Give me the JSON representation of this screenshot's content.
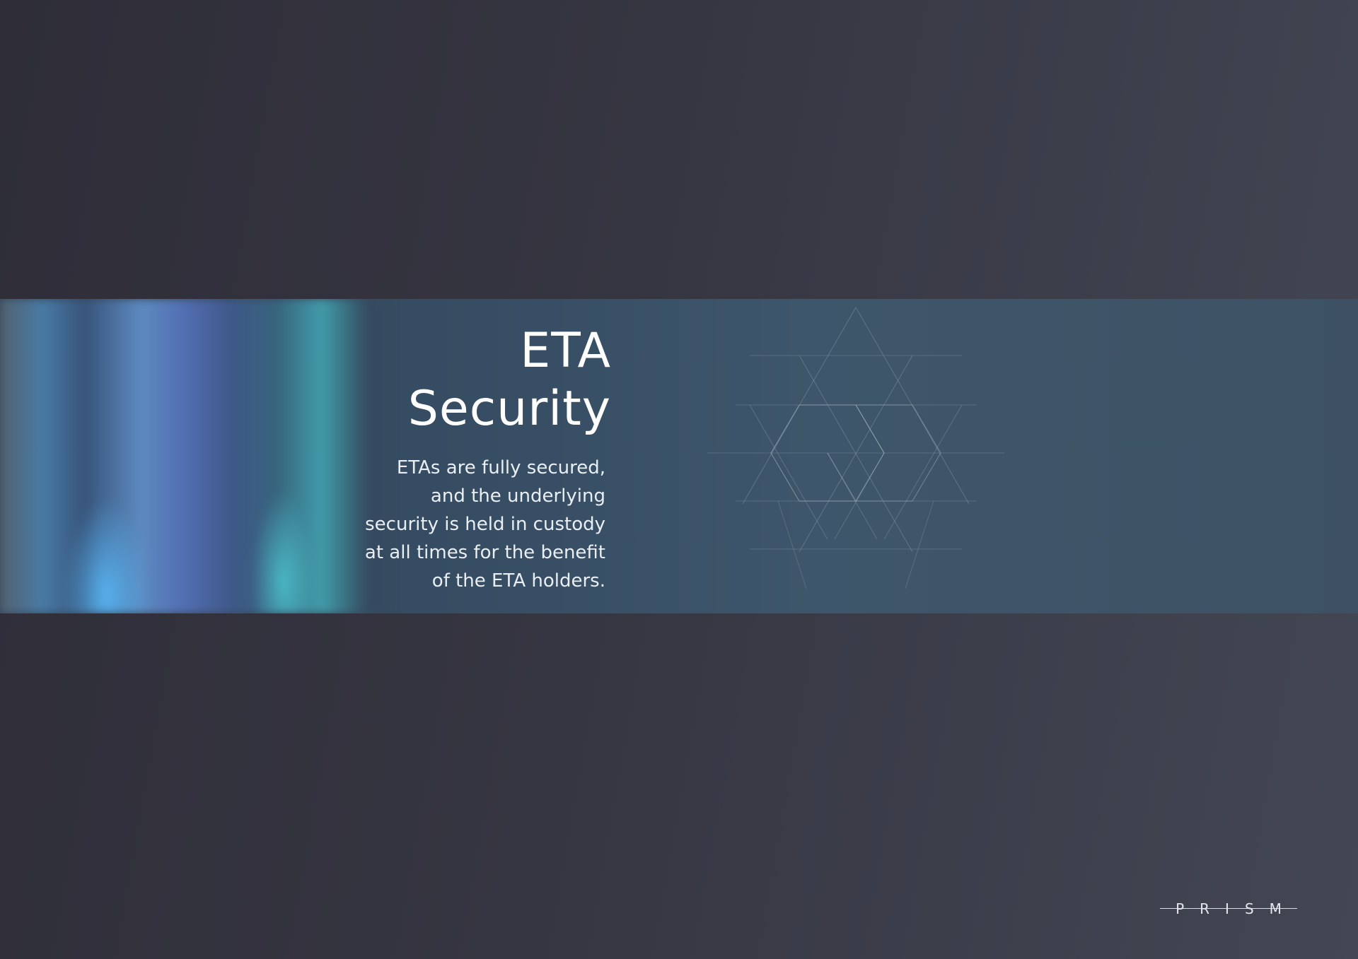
{
  "colors": {
    "background": "#363642",
    "band": "#374e64",
    "text": "#ffffff"
  },
  "section": {
    "title_line1": "ETA",
    "title_line2": "Security",
    "body_lines": [
      "ETAs are fully secured,",
      "and the underlying",
      "security is held in custody",
      "at all times for the benefit",
      "of the ETA holders."
    ]
  },
  "brand": {
    "logo_text": "PRISM"
  },
  "decor": {
    "streaks": "blurred-light-streaks",
    "pattern": "hexagon-line-pattern"
  }
}
